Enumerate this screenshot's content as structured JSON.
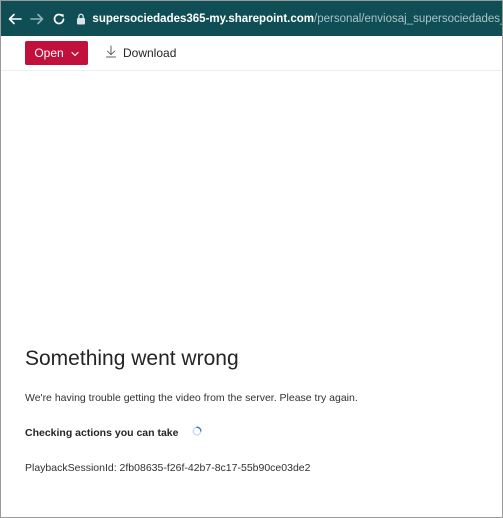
{
  "browser": {
    "back_icon": "arrow-left-icon",
    "forward_icon": "arrow-right-icon",
    "reload_icon": "reload-icon",
    "lock_icon": "lock-icon",
    "url_host": "supersociedades365-my.sharepoint.com",
    "url_path": "/personal/enviosaj_supersociedades_gov_co/_lay",
    "bar_color": "#0f4e54"
  },
  "toolbar": {
    "open_label": "Open",
    "open_color": "#c1103c",
    "download_label": "Download"
  },
  "error": {
    "title": "Something went wrong",
    "message": "We're having trouble getting the video from the server. Please try again.",
    "checking_label": "Checking actions you can take",
    "session_id": "PlaybackSessionId: 2fb08635-f26f-42b7-8c17-55b90ce03de2"
  }
}
